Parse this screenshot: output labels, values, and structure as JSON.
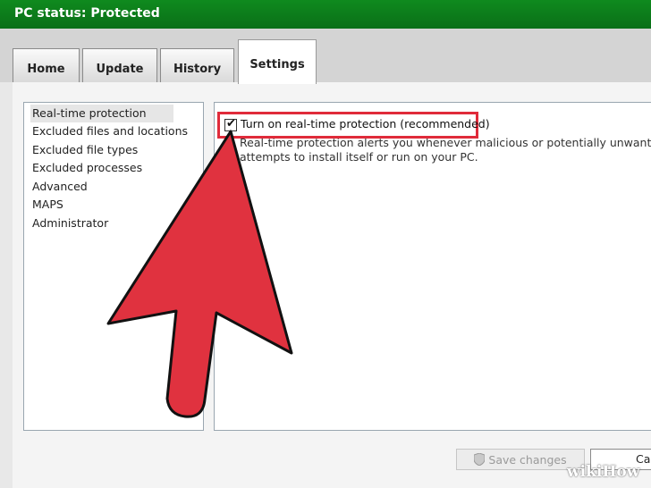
{
  "header": {
    "status": "PC status: Protected"
  },
  "tabs": [
    {
      "label": "Home",
      "active": false
    },
    {
      "label": "Update",
      "active": false
    },
    {
      "label": "History",
      "active": false
    },
    {
      "label": "Settings",
      "active": true
    }
  ],
  "sidebar": {
    "items": [
      {
        "label": "Real-time protection",
        "selected": true
      },
      {
        "label": "Excluded files and locations",
        "selected": false
      },
      {
        "label": "Excluded file types",
        "selected": false
      },
      {
        "label": "Excluded processes",
        "selected": false
      },
      {
        "label": "Advanced",
        "selected": false
      },
      {
        "label": "MAPS",
        "selected": false
      },
      {
        "label": "Administrator",
        "selected": false
      }
    ]
  },
  "main": {
    "checkbox_label": "Turn on real-time protection (recommended)",
    "checkbox_checked": true,
    "description_line1": "Real-time protection alerts you whenever malicious or potentially unwanted software",
    "description_line2": "attempts to install itself or run on your PC."
  },
  "footer": {
    "save_label": "Save changes",
    "cancel_label": "Cancel"
  },
  "watermark": "wikiHow",
  "colors": {
    "titlebar": "#0f8a1e",
    "highlight": "#e02b3a",
    "arrow": "#e0323f"
  }
}
